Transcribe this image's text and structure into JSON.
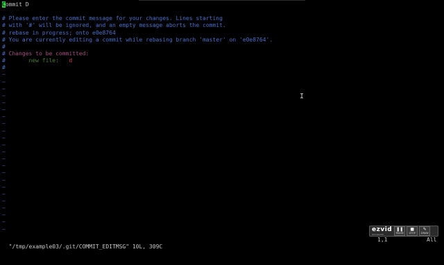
{
  "editor": {
    "lines": [
      {
        "type": "commit",
        "cursor_char": "C",
        "rest": "ommit D"
      },
      {
        "type": "blank",
        "text": ""
      },
      {
        "type": "comment",
        "text": "# Please enter the commit message for your changes. Lines starting"
      },
      {
        "type": "comment",
        "text": "# with '#' will be ignored, and an empty message aborts the commit."
      },
      {
        "type": "comment",
        "text": "# rebase in progress; onto e0e8764"
      },
      {
        "type": "comment",
        "text": "# You are currently editing a commit while rebasing branch 'master' on 'e0e8764'."
      },
      {
        "type": "comment",
        "text": "#"
      },
      {
        "type": "changes",
        "hash": "# ",
        "text": "Changes to be committed:"
      },
      {
        "type": "newfile",
        "hash": "#       ",
        "label": "new file:",
        "pad": "   ",
        "file": "d"
      },
      {
        "type": "comment",
        "text": "#"
      }
    ],
    "tilde": "~",
    "tilde_count": 23
  },
  "status_bar": {
    "file_info": "\"/tmp/example03/.git/COMMIT_EDITMSG\" 10L, 309C",
    "position": "1,1",
    "scroll": "All"
  },
  "mouse_cursor_icon": "text-cursor-icon",
  "watermark": {
    "logo": "ezvid",
    "sub": "RECORDER",
    "buttons": [
      {
        "label": "PAUSE",
        "icon": "pause-icon",
        "glyph": "❚❚"
      },
      {
        "label": "STOP",
        "icon": "stop-icon",
        "glyph": "■"
      },
      {
        "label": "DRAW",
        "icon": "draw-icon",
        "glyph": "✎"
      }
    ]
  },
  "colors": {
    "background": "#000000",
    "comment": "#4a70c8",
    "changes_header": "#a05080",
    "new_file_label": "#4a7a3a",
    "file_name": "#c84040",
    "tilde": "#4050b0",
    "cursor": "#2ecc40"
  }
}
